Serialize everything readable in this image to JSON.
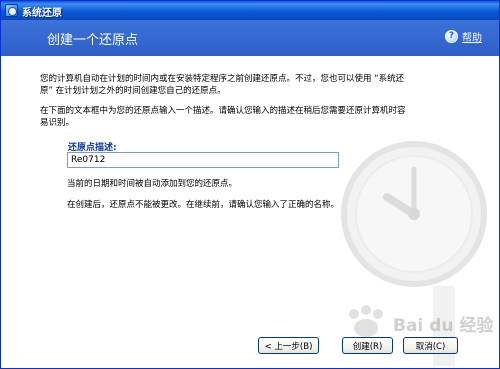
{
  "window": {
    "title": "系统还原"
  },
  "header": {
    "title": "创建一个还原点",
    "help_label": "帮助"
  },
  "main": {
    "intro": "您的计算机自动在计划的时间内或在安装特定程序之前创建还原点。不过，您也可以使用 “系统还原” 在计划计划之外的时间创建您自己的还原点。",
    "instruction": "在下面的文本框中为您的还原点输入一个描述。请确认您输入的描述在稍后您需要还原计算机时容易识别。",
    "field_label": "还原点描述:",
    "field_value": "Re0712",
    "note_date": "当前的日期和时间被自动添加到您的还原点。",
    "note_warning": "在创建后，还原点不能被更改。在继续前，请确认您输入了正确的名称。"
  },
  "footer": {
    "back_label": "< 上一步(B)",
    "create_label": "创建(R)",
    "cancel_label": "取消(C)"
  },
  "watermark": {
    "text": "Bai du 经验"
  },
  "colors": {
    "title_bar": "#0b59d2",
    "header_band": "#3468d4",
    "label_blue": "#0a3aa8",
    "button_border": "#003c74"
  }
}
